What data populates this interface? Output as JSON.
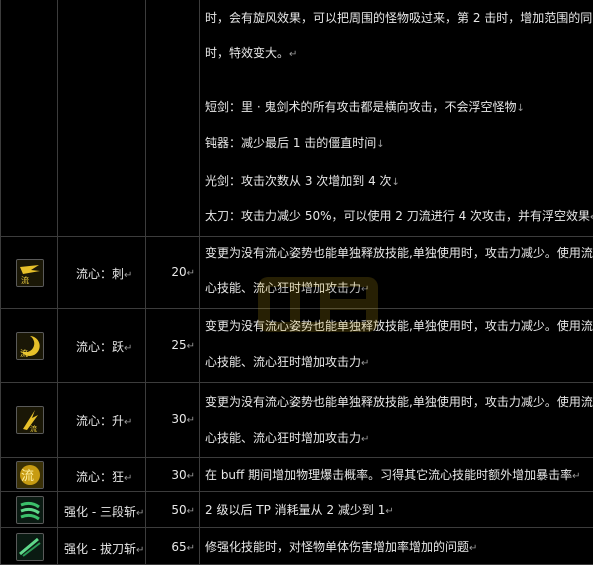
{
  "top_description": {
    "lines": [
      {
        "text": "时，会有旋风效果，可以把周围的怪物吸过来，第 2 击时，增加范围的同",
        "mark": ""
      },
      {
        "text": "时，特效变大。",
        "mark": "↵"
      },
      {
        "text": "短剑：里 · 鬼剑术的所有攻击都是横向攻击，不会浮空怪物",
        "mark": "↓"
      },
      {
        "text": "钝器：减少最后 1 击的僵直时间",
        "mark": "↓"
      },
      {
        "text": "光剑：攻击次数从 3 次增加到 4 次",
        "mark": "↓"
      },
      {
        "text": "太刀：攻击力减少 50%，可以使用 2 刀流进行 4 次攻击，并有浮空效果",
        "mark": "↵"
      }
    ]
  },
  "skills": [
    {
      "icon": "liuxin-ci-icon",
      "name": "流心：刺",
      "name_mark": "↵",
      "level": "20",
      "level_mark": "↵",
      "desc_lines": [
        "变更为没有流心姿势也能单独释放技能,单独使用时，攻击力减少。使用流",
        "心技能、流心狂时增加攻击力"
      ],
      "desc_mark": "↵"
    },
    {
      "icon": "liuxin-yue-icon",
      "name": "流心：跃",
      "name_mark": "↵",
      "level": "25",
      "level_mark": "↵",
      "desc_lines": [
        "变更为没有流心姿势也能单独释放技能,单独使用时，攻击力减少。使用流",
        "心技能、流心狂时增加攻击力"
      ],
      "desc_mark": "↵"
    },
    {
      "icon": "liuxin-sheng-icon",
      "name": "流心：升",
      "name_mark": "↵",
      "level": "30",
      "level_mark": "↵",
      "desc_lines": [
        "变更为没有流心姿势也能单独释放技能,单独使用时，攻击力减少。使用流",
        "心技能、流心狂时增加攻击力"
      ],
      "desc_mark": "↵"
    },
    {
      "icon": "liuxin-kuang-icon",
      "name": "流心：狂",
      "name_mark": "↵",
      "level": "30",
      "level_mark": "↵",
      "desc_lines": [
        "在 buff 期间增加物理爆击概率。习得其它流心技能时额外增加暴击率"
      ],
      "desc_mark": "↵"
    },
    {
      "icon": "qianghua-sanduanzhan-icon",
      "name": "强化 - 三段斩",
      "name_mark": "↵",
      "level": "50",
      "level_mark": "↵",
      "desc_lines": [
        "2 级以后 TP 消耗量从 2 减少到 1"
      ],
      "desc_mark": "↵"
    },
    {
      "icon": "qianghua-badaozhan-icon",
      "name": "强化 - 拔刀斩",
      "name_mark": "↵",
      "level": "65",
      "level_mark": "↵",
      "desc_lines": [
        "修强化技能时，对怪物单体伤害增加率增加的问题"
      ],
      "desc_mark": "↵"
    }
  ],
  "colors": {
    "background": "#000000",
    "text": "#e8e8e8",
    "border": "#3c3c3c",
    "icon_gold": "#d9b21b",
    "icon_green": "#3bbf6a"
  }
}
